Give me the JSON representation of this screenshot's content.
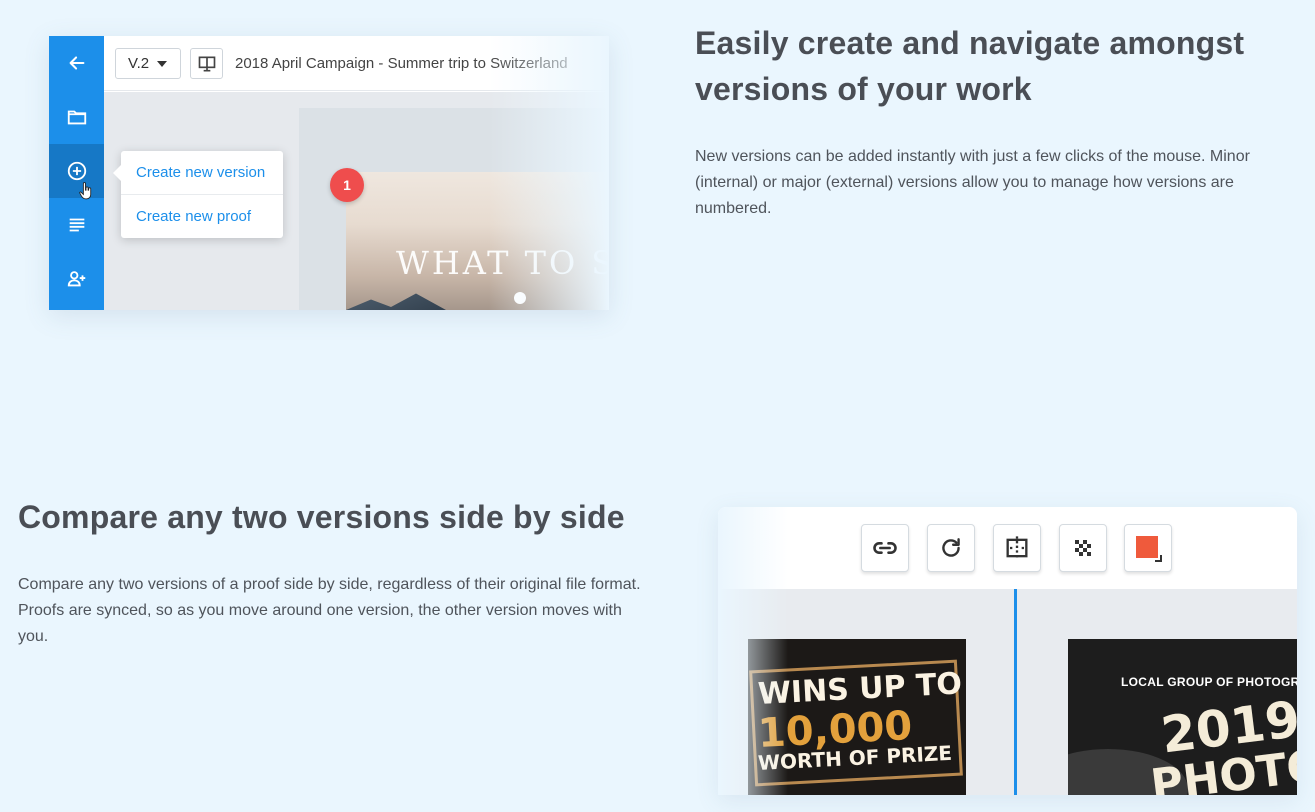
{
  "colors": {
    "background": "#eaf6fe",
    "accent": "#1c8fea",
    "heading": "#4a4e55",
    "badge": "#ef4d4d",
    "color_swatch": "#ef5a3c"
  },
  "section1": {
    "heading": "Easily create and navigate amongst versions of your work",
    "body": "New versions can be added instantly with just a few clicks of the mouse. Minor (internal) or major (external) versions allow you to manage how versions are numbered.",
    "mockup": {
      "sidebar_icons": [
        "arrow-left-icon",
        "folder-icon",
        "plus-circle-icon",
        "list-icon",
        "add-user-icon"
      ],
      "version_select": "V.2",
      "document_title": "2018 April Campaign - Summer trip to Switzerland",
      "menu": {
        "create_version": "Create new version",
        "create_proof": "Create new proof"
      },
      "badge_number": "1",
      "poster_title": "WHAT TO SE"
    }
  },
  "section2": {
    "heading": "Compare any two versions side by side",
    "body": "Compare any two versions of a proof side by side, regardless of their original file format. Proofs are synced, so as you move around one version, the other version moves with you.",
    "mockup": {
      "toolbar_icons": [
        "link-icon",
        "refresh-icon",
        "compare-split-icon",
        "checker-icon",
        "color-swatch-icon"
      ],
      "left_poster": {
        "line1": "WINS UP TO",
        "line2": "10,000",
        "line3": "WORTH OF PRIZE"
      },
      "right_poster": {
        "small": "LOCAL GROUP OF PHOTOGRA",
        "big1": "2019",
        "big2": "PHOTO"
      }
    }
  }
}
